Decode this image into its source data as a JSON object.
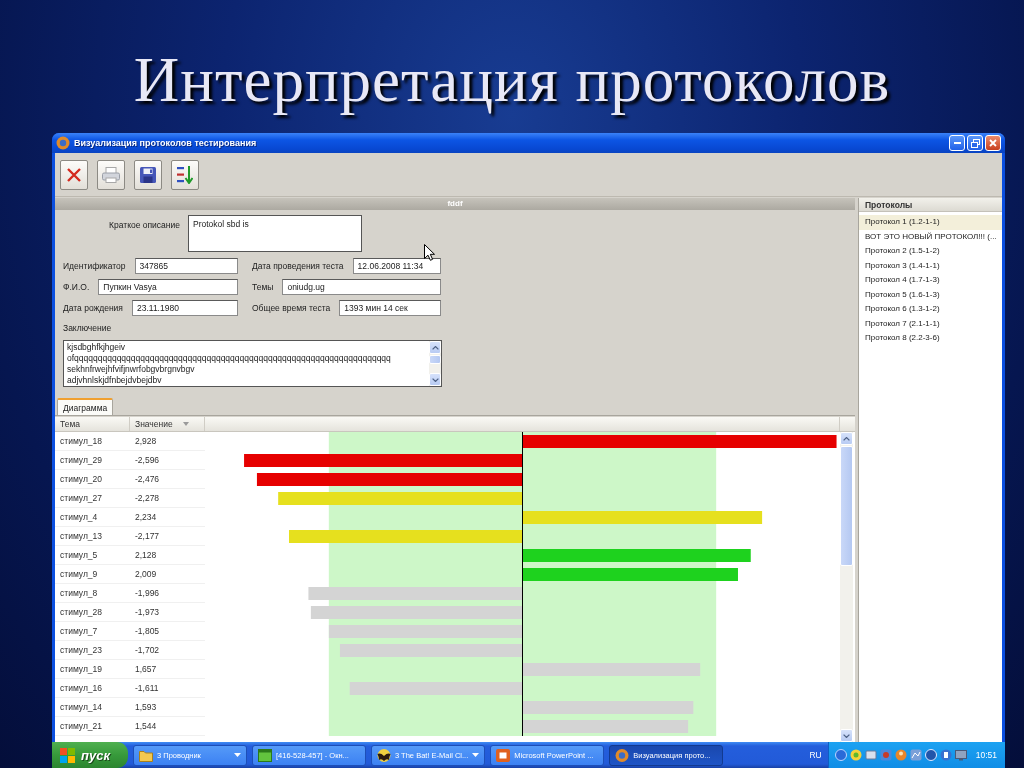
{
  "slide": {
    "title": "Интерпретация протоколов"
  },
  "window": {
    "title": "Визуализация протоколов тестирования"
  },
  "toolbar": [
    {
      "kind": "delete"
    },
    {
      "kind": "print"
    },
    {
      "kind": "save"
    },
    {
      "kind": "sort"
    }
  ],
  "record": {
    "header": "fddf",
    "description": {
      "label": "Краткое описание",
      "value": "Protokol sbd is"
    },
    "fields": [
      {
        "label": "Идентификатор",
        "value": "347865"
      },
      {
        "label": "Дата проведения теста",
        "value": "12.06.2008 11:34"
      },
      {
        "label": "Ф.И.О.",
        "value": "Пупкин Vasya"
      },
      {
        "label": "Темы",
        "value": "oniudg.ug"
      },
      {
        "label": "Дата рождения",
        "value": "23.11.1980"
      },
      {
        "label": "Общее время теста",
        "value": "1393 мин 14 сек"
      }
    ],
    "conclusion": {
      "label": "Заключение",
      "value": "kjsdbghfkjhgeiv\nofqqqqqqqqqqqqqqqqqqqqqqqqqqqqqqqqqqqqqqqqqqqqqqqqqqqqqqqqqqqqqqqqqqq\nsekhnfrwejhfvifjnwrfobgvbrgnvbgv\nadjvhnlskjdfnbejdvbejdbv"
    }
  },
  "tabs": [
    {
      "label": "Диаграмма",
      "selected": true
    }
  ],
  "table": {
    "columns": [
      {
        "label": "Тема",
        "sorted": false
      },
      {
        "label": "Значение",
        "sorted": true
      }
    ],
    "rows": [
      {
        "topic": "стимул_18",
        "value": "2,928",
        "color": "#e60000"
      },
      {
        "topic": "стимул_29",
        "value": "-2,596",
        "color": "#e60000"
      },
      {
        "topic": "стимул_20",
        "value": "-2,476",
        "color": "#e60000"
      },
      {
        "topic": "стимул_27",
        "value": "-2,278",
        "color": "#e6e01e"
      },
      {
        "topic": "стимул_4",
        "value": "2,234",
        "color": "#e6e01e"
      },
      {
        "topic": "стимул_13",
        "value": "-2,177",
        "color": "#e6e01e"
      },
      {
        "topic": "стимул_5",
        "value": "2,128",
        "color": "#1ed21e"
      },
      {
        "topic": "стимул_9",
        "value": "2,009",
        "color": "#1ed21e"
      },
      {
        "topic": "стимул_8",
        "value": "-1,996",
        "color": "#d4d4d4"
      },
      {
        "topic": "стимул_28",
        "value": "-1,973",
        "color": "#d4d4d4"
      },
      {
        "topic": "стимул_7",
        "value": "-1,805",
        "color": "#d4d4d4"
      },
      {
        "topic": "стимул_23",
        "value": "-1,702",
        "color": "#d4d4d4"
      },
      {
        "topic": "стимул_19",
        "value": "1,657",
        "color": "#d4d4d4"
      },
      {
        "topic": "стимул_16",
        "value": "-1,611",
        "color": "#d4d4d4"
      },
      {
        "topic": "стимул_14",
        "value": "1,593",
        "color": "#d4d4d4"
      },
      {
        "topic": "стимул_21",
        "value": "1,544",
        "color": "#d4d4d4"
      }
    ]
  },
  "protocols": {
    "title": "Протоколы",
    "items": [
      {
        "label": "Протокол 1 (1.2-1-1)",
        "selected": true
      },
      {
        "label": "ВОТ ЭТО НОВЫЙ ПРОТОКОЛ!!! (...",
        "selected": false
      },
      {
        "label": "Протокол 2 (1.5-1-2)",
        "selected": false
      },
      {
        "label": "Протокол 3 (1.4-1-1)",
        "selected": false
      },
      {
        "label": "Протокол 4 (1.7-1-3)",
        "selected": false
      },
      {
        "label": "Протокол 5 (1.6-1-3)",
        "selected": false
      },
      {
        "label": "Протокол 6 (1.3-1-2)",
        "selected": false
      },
      {
        "label": "Протокол 7 (2.1-1-1)",
        "selected": false
      },
      {
        "label": "Протокол 8 (2.2-3-6)",
        "selected": false
      }
    ]
  },
  "taskbar": {
    "start": "пуск",
    "buttons": [
      {
        "kind": "folder",
        "label": "3 Проводник",
        "grouped": true,
        "selected": false
      },
      {
        "kind": "window",
        "label": "[416-528-457] - Окн...",
        "grouped": false,
        "selected": false
      },
      {
        "kind": "bat",
        "label": "3 The Bat! E-Mail Cl...",
        "grouped": true,
        "selected": false
      },
      {
        "kind": "slides",
        "label": "Microsoft PowerPoint ...",
        "grouped": false,
        "selected": false
      },
      {
        "kind": "app",
        "label": "Визуализация прото...",
        "grouped": false,
        "selected": true
      }
    ],
    "language": "RU",
    "clock": "10:51"
  }
}
